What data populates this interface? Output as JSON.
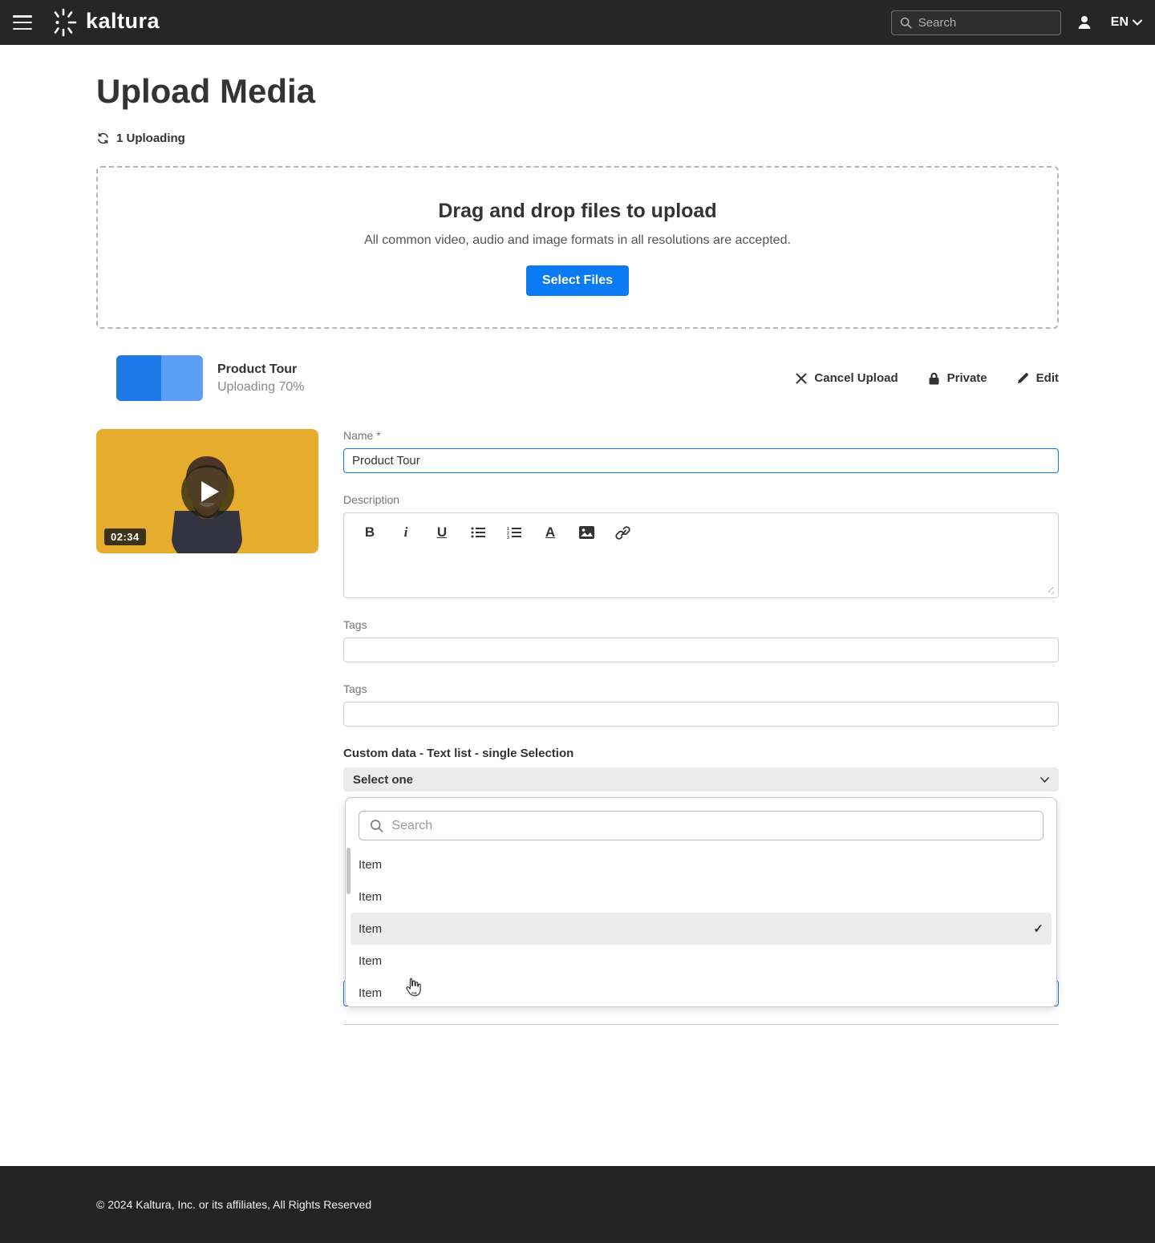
{
  "nav": {
    "search_placeholder": "Search",
    "language": "EN"
  },
  "page": {
    "title": "Upload Media",
    "uploading_status": "1 Uploading",
    "footer_text": "© 2024 Kaltura, Inc. or its affiliates, All Rights Reserved"
  },
  "dropzone": {
    "title": "Drag and drop files to upload",
    "subtitle": "All common video, audio and image formats in all resolutions are accepted.",
    "select_files_label": "Select Files"
  },
  "upload_item": {
    "name": "Product Tour",
    "status": "Uploading 70%",
    "progress_percent": 70,
    "progress_fill_visual_percent": 52,
    "duration": "02:34",
    "actions": {
      "cancel_label": "Cancel Upload",
      "privacy_label": "Private",
      "edit_label": "Edit"
    }
  },
  "form": {
    "name": {
      "label": "Name *",
      "value": "Product Tour"
    },
    "description": {
      "label": "Description",
      "value": "",
      "toolbar": {
        "bold": "B",
        "italic": "i",
        "underline": "U",
        "text_color": "A"
      }
    },
    "tags": [
      {
        "label": "Tags",
        "value": ""
      },
      {
        "label": "Tags",
        "value": ""
      }
    ],
    "custom_data": {
      "label": "Custom data - Text list -  single Selection",
      "selected_value": "Select one",
      "search_placeholder": "Search",
      "options": [
        {
          "label": "Item",
          "selected": false
        },
        {
          "label": "Item",
          "selected": false
        },
        {
          "label": "Item",
          "selected": true
        },
        {
          "label": "Item",
          "selected": false
        },
        {
          "label": "Item",
          "selected": false
        }
      ]
    }
  },
  "glyphs": {
    "check": "✓"
  },
  "colors": {
    "accent_blue": "#0b7af5",
    "progress_dark": "#1d79e8",
    "progress_light": "#5c9ef5",
    "nav_bg": "#262626",
    "footer_bg": "#232323",
    "select_bg": "#ebebeb",
    "thumb_yellow": "#e6ac2d"
  },
  "icons": {
    "nav": [
      "hamburger-menu-icon",
      "kaltura-logo",
      "search-icon",
      "user-icon",
      "chevron-down-icon"
    ],
    "page": [
      "refresh-icon",
      "close-icon",
      "lock-icon",
      "pencil-icon",
      "play-icon"
    ],
    "editor": [
      "bulleted-list-icon",
      "numbered-list-icon",
      "image-icon",
      "link-icon"
    ],
    "dropdown": [
      "search-icon",
      "check-icon",
      "hand-pointer-cursor"
    ]
  }
}
